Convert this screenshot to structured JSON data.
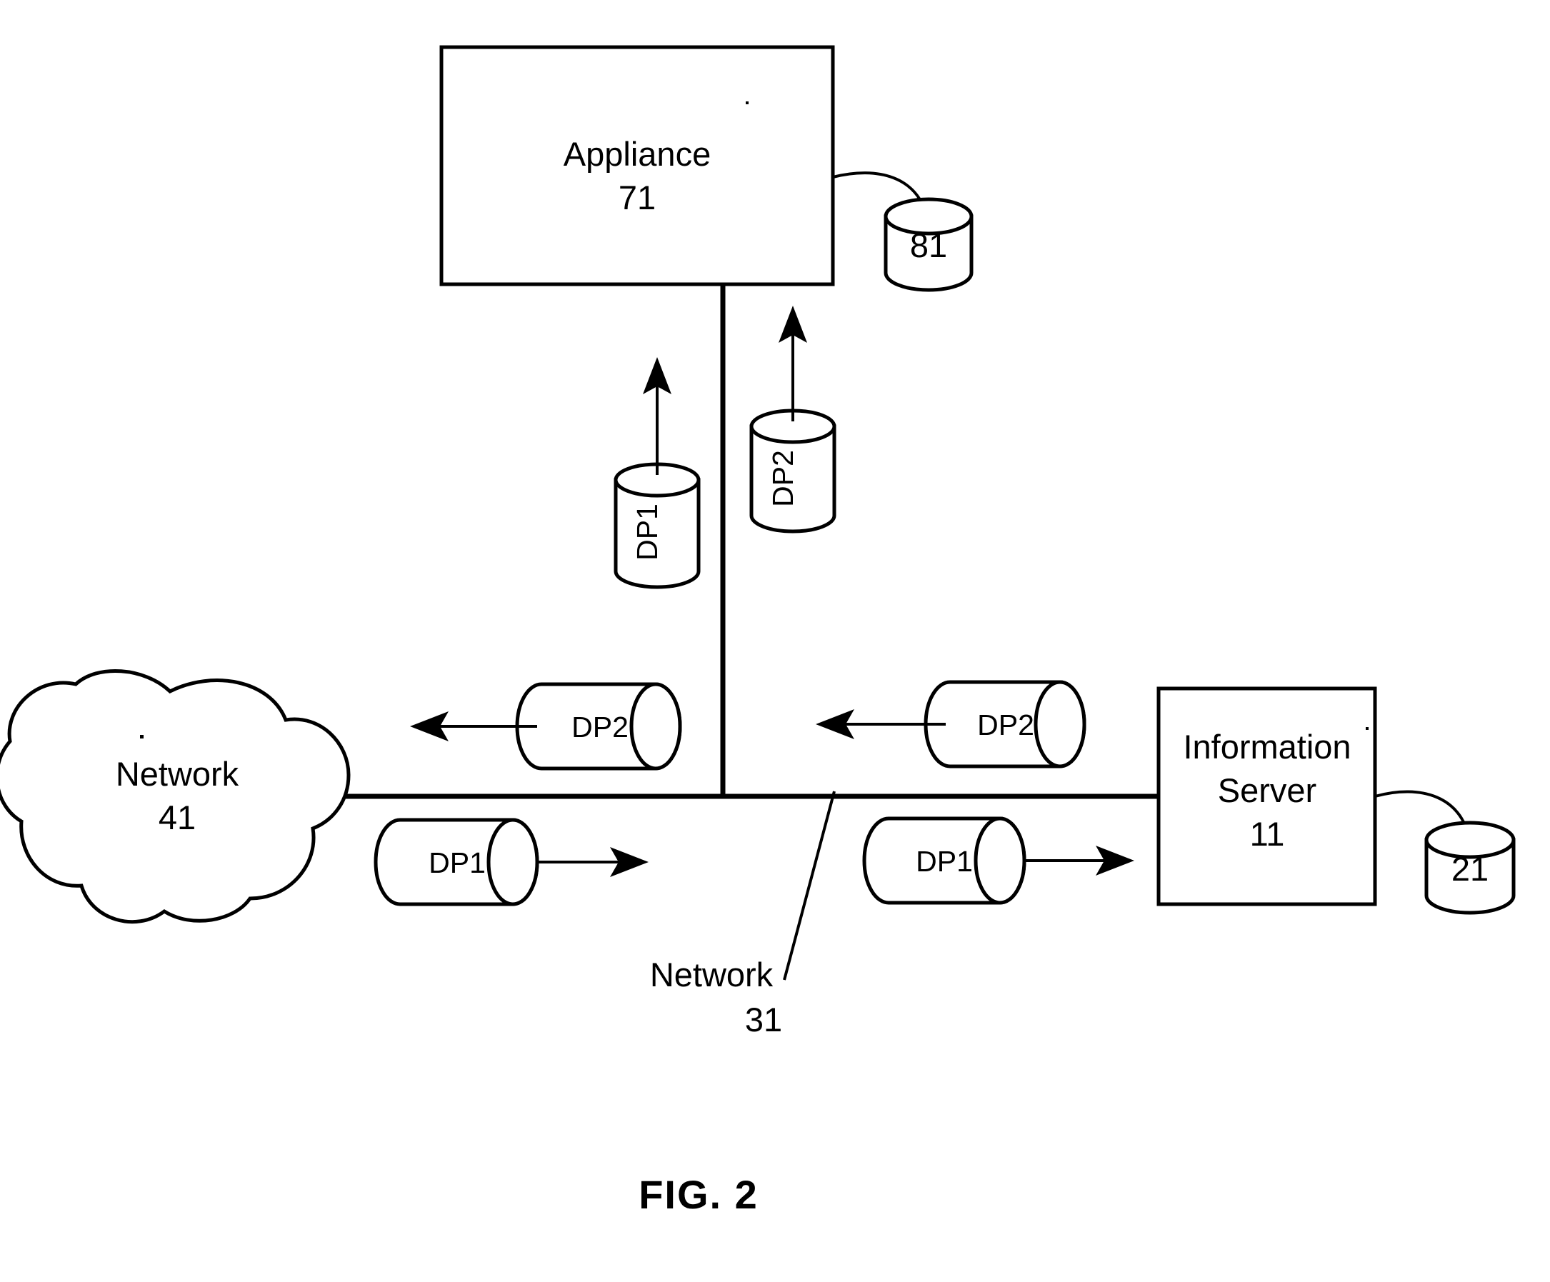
{
  "figure": {
    "caption": "FIG. 2",
    "type": "patent-network-diagram"
  },
  "nodes": {
    "appliance": {
      "name_line1": "Appliance",
      "name_line2": "71",
      "shape": "rectangle"
    },
    "information_server": {
      "name_line1": "Information",
      "name_line2": "Server",
      "name_line3": "11",
      "shape": "rectangle"
    },
    "network_41": {
      "name_line1": "Network",
      "name_line2": "41",
      "shape": "cloud"
    },
    "network_31": {
      "name_line1": "Network",
      "name_line2": "31",
      "shape": "leader-label"
    }
  },
  "storage": {
    "appliance_store": {
      "label": "81",
      "shape": "cylinder-vertical"
    },
    "server_store": {
      "label": "21",
      "shape": "cylinder-vertical"
    }
  },
  "data_packets": {
    "appliance_in_dp1": {
      "label": "DP1",
      "orientation": "vertical",
      "direction": "up"
    },
    "appliance_out_dp2": {
      "label": "DP2",
      "orientation": "vertical",
      "direction": "up"
    },
    "network_dp2_left": {
      "label": "DP2",
      "orientation": "horizontal",
      "direction": "left"
    },
    "network_dp1_left": {
      "label": "DP1",
      "orientation": "horizontal",
      "direction": "right"
    },
    "server_dp2": {
      "label": "DP2",
      "orientation": "horizontal",
      "direction": "left"
    },
    "server_dp1": {
      "label": "DP1",
      "orientation": "horizontal",
      "direction": "right"
    }
  },
  "colors": {
    "line": "#000000",
    "fill": "#ffffff",
    "background": "#ffffff"
  }
}
